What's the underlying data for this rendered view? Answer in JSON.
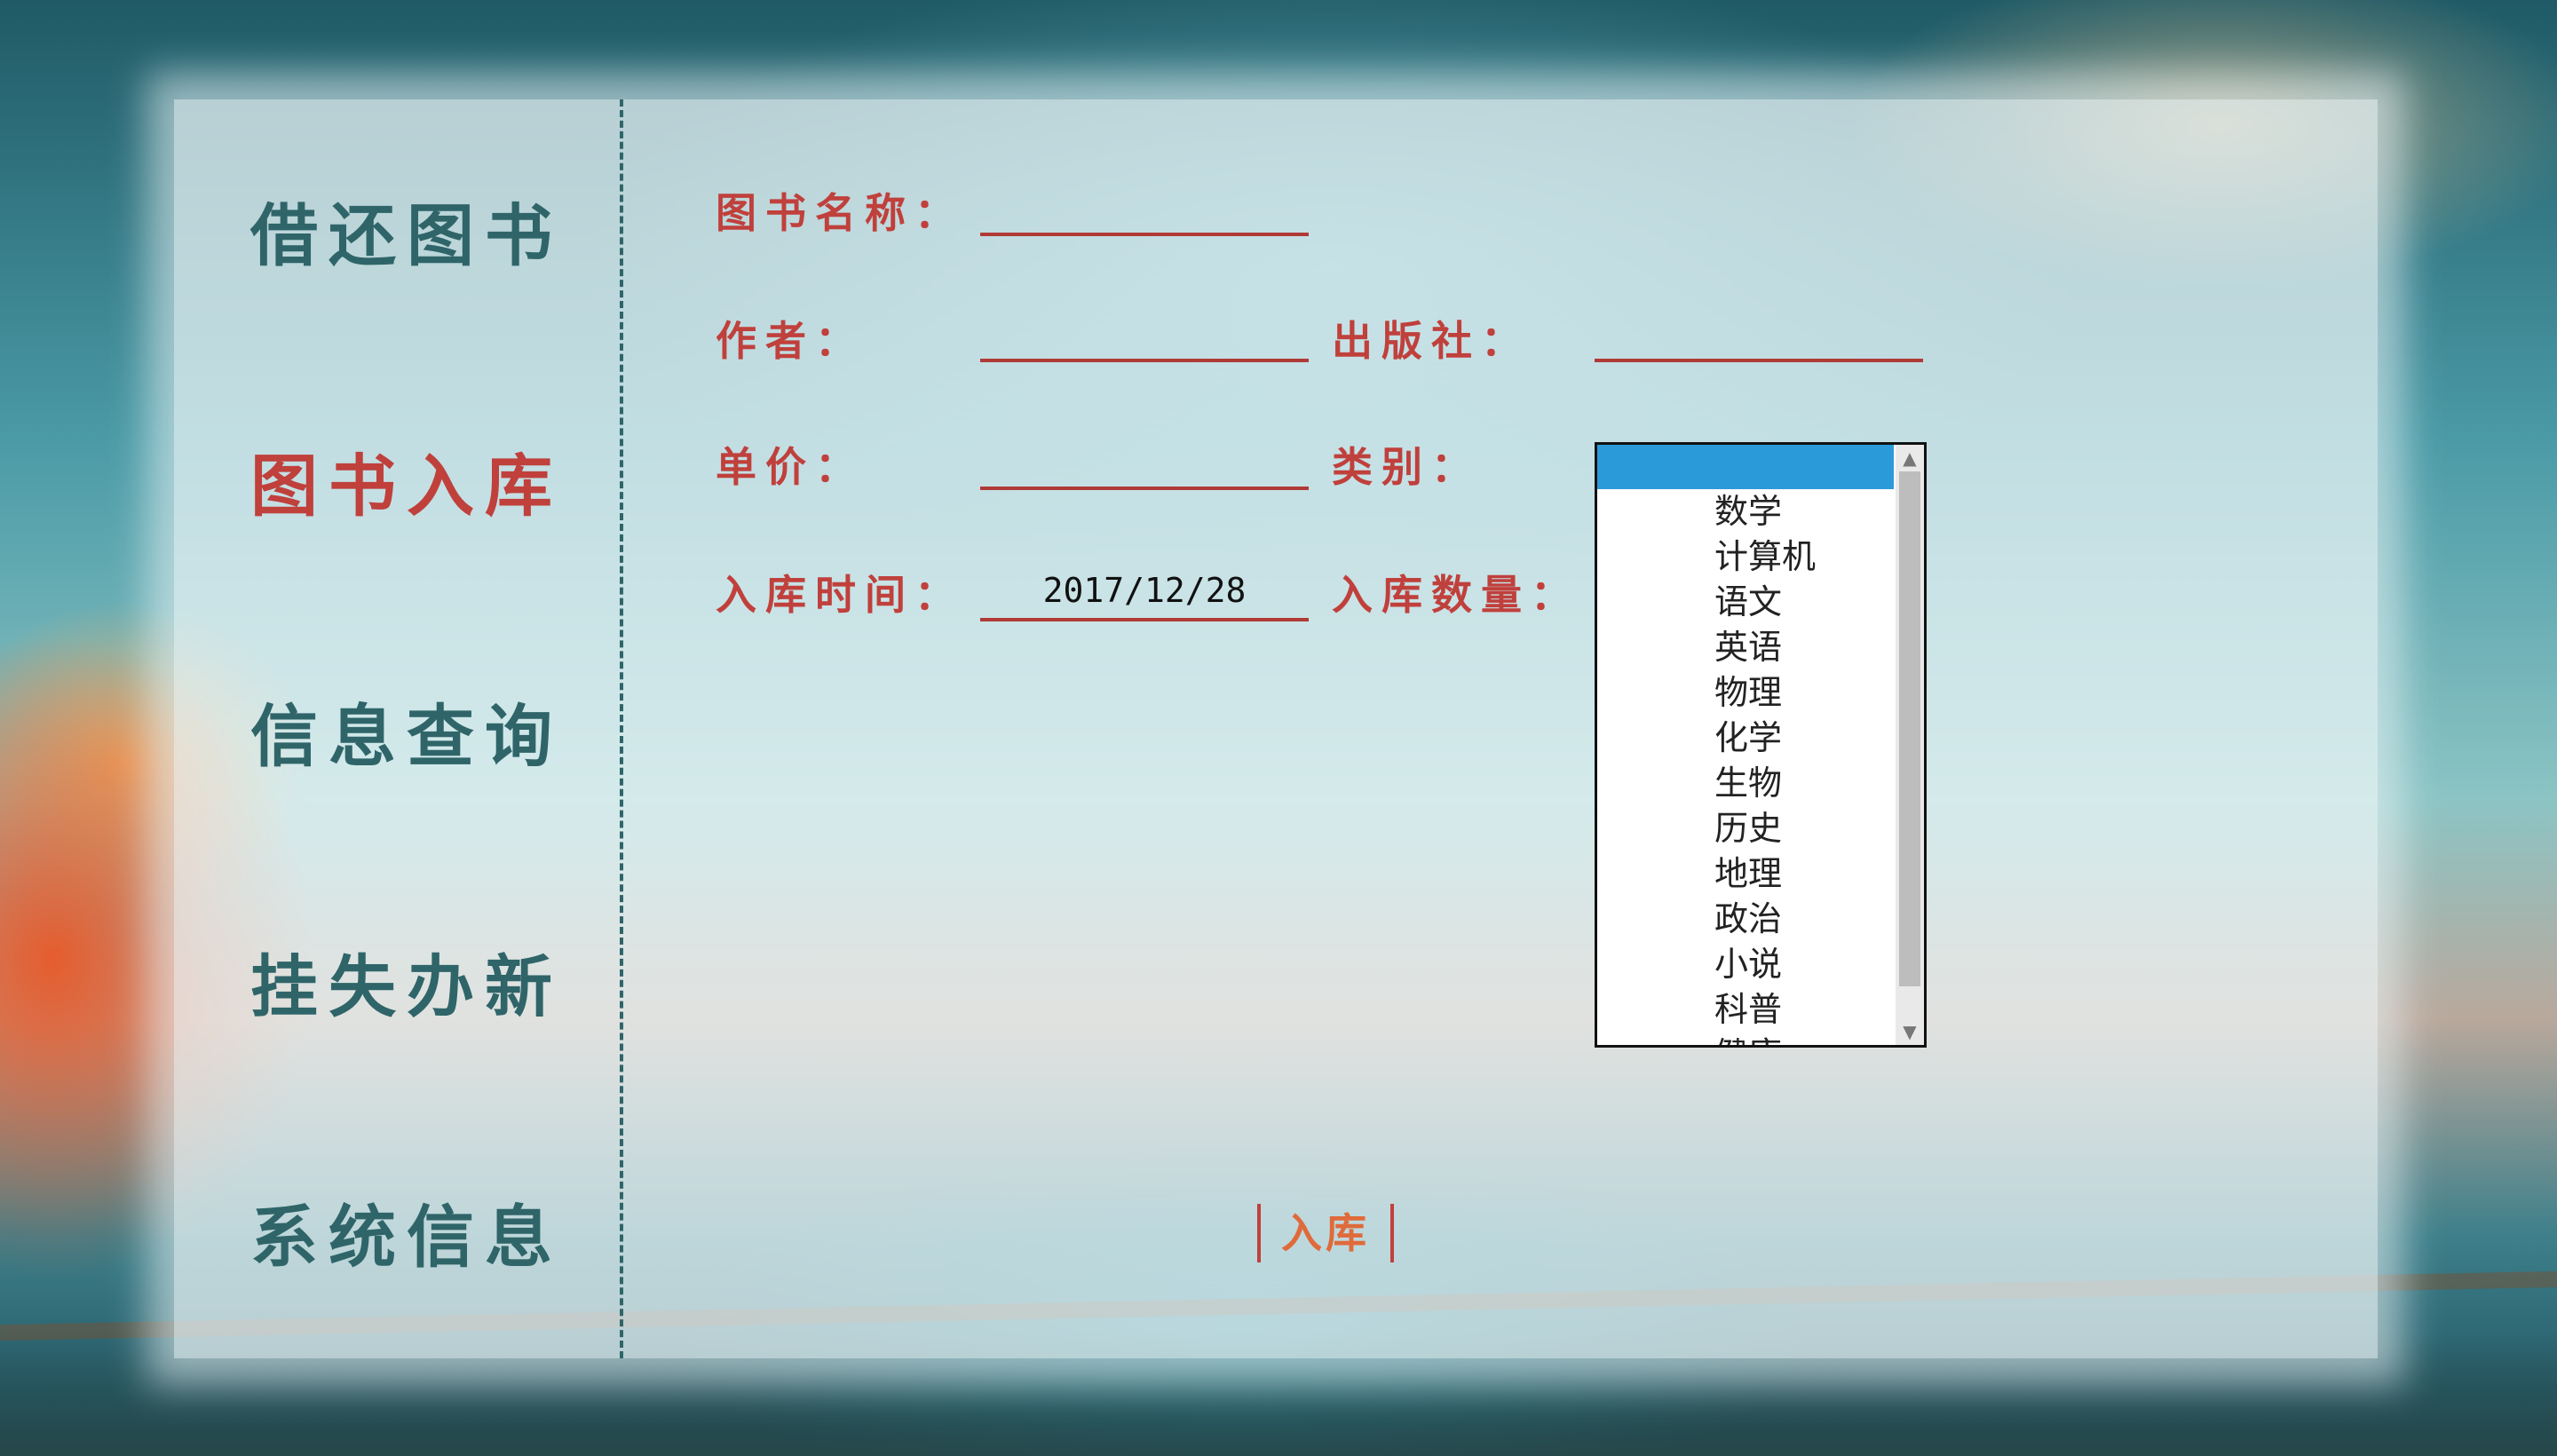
{
  "sidebar": {
    "items": [
      {
        "label": "借还图书"
      },
      {
        "label": "图书入库"
      },
      {
        "label": "信息查询"
      },
      {
        "label": "挂失办新"
      },
      {
        "label": "系统信息"
      }
    ]
  },
  "form": {
    "book_name_label": "图书名称：",
    "author_label": "作者：",
    "publisher_label": "出版社：",
    "price_label": "单价：",
    "category_label": "类别：",
    "date_label": "入库时间：",
    "quantity_label": "入库数量：",
    "date_value": "2017/12/28",
    "categories": [
      "数学",
      "计算机",
      "语文",
      "英语",
      "物理",
      "化学",
      "生物",
      "历史",
      "地理",
      "政治",
      "小说",
      "科普",
      "健康"
    ],
    "submit_label": "入库"
  },
  "colors": {
    "accent_red": "#c0403c",
    "nav_teal": "#2f6569",
    "submit_orange": "#e06a3a",
    "list_selection": "#2b9ad9"
  },
  "icons": {
    "scroll_up": "chevron-up-icon",
    "scroll_down": "chevron-down-icon"
  }
}
